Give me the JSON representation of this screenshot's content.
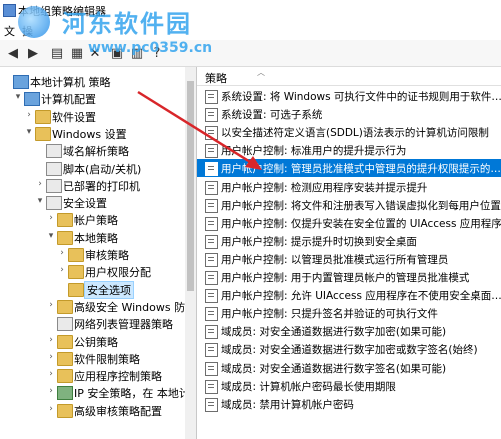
{
  "window": {
    "title": "本地组策略编辑器"
  },
  "menu": {
    "items": [
      "文",
      "操"
    ]
  },
  "watermark": {
    "name": "河东软件园",
    "url": "www.pc0359.cn"
  },
  "tree": {
    "items": [
      {
        "label": "本地计算机 策略",
        "level": 0,
        "expander": "",
        "icon": "computer"
      },
      {
        "label": "计算机配置",
        "level": 1,
        "expander": "▾",
        "icon": "computer"
      },
      {
        "label": "软件设置",
        "level": 2,
        "expander": "›",
        "icon": "folder"
      },
      {
        "label": "Windows 设置",
        "level": 2,
        "expander": "▾",
        "icon": "folder"
      },
      {
        "label": "域名解析策略",
        "level": 3,
        "expander": "",
        "icon": "book"
      },
      {
        "label": "脚本(启动/关机)",
        "level": 3,
        "expander": "",
        "icon": "book"
      },
      {
        "label": "已部署的打印机",
        "level": 3,
        "expander": "›",
        "icon": "book"
      },
      {
        "label": "安全设置",
        "level": 3,
        "expander": "▾",
        "icon": "book"
      },
      {
        "label": "帐户策略",
        "level": 4,
        "expander": "›",
        "icon": "folder"
      },
      {
        "label": "本地策略",
        "level": 4,
        "expander": "▾",
        "icon": "folder"
      },
      {
        "label": "审核策略",
        "level": 5,
        "expander": "›",
        "icon": "folder"
      },
      {
        "label": "用户权限分配",
        "level": 5,
        "expander": "›",
        "icon": "folder"
      },
      {
        "label": "安全选项",
        "level": 5,
        "expander": "",
        "icon": "folder",
        "selected": true
      },
      {
        "label": "高级安全 Windows 防火",
        "level": 4,
        "expander": "›",
        "icon": "folder"
      },
      {
        "label": "网络列表管理器策略",
        "level": 4,
        "expander": "",
        "icon": "book"
      },
      {
        "label": "公钥策略",
        "level": 4,
        "expander": "›",
        "icon": "folder"
      },
      {
        "label": "软件限制策略",
        "level": 4,
        "expander": "›",
        "icon": "folder"
      },
      {
        "label": "应用程序控制策略",
        "level": 4,
        "expander": "›",
        "icon": "folder"
      },
      {
        "label": "IP 安全策略，在 本地计",
        "level": 4,
        "expander": "›",
        "icon": "net"
      },
      {
        "label": "高级审核策略配置",
        "level": 4,
        "expander": "›",
        "icon": "folder"
      }
    ]
  },
  "list": {
    "column_header": "策略",
    "rows": [
      "系统设置: 将 Windows 可执行文件中的证书规则用于软件…",
      "系统设置: 可选子系统",
      "以安全描述符定义语言(SDDL)语法表示的计算机访问限制",
      "用户帐户控制: 标准用户的提升提示行为",
      "用户帐户控制: 管理员批准模式中管理员的提升权限提示的…",
      "用户帐户控制: 检测应用程序安装并提示提升",
      "用户帐户控制: 将文件和注册表写入错误虚拟化到每用户位置",
      "用户帐户控制: 仅提升安装在安全位置的 UIAccess 应用程序",
      "用户帐户控制: 提示提升时切换到安全桌面",
      "用户帐户控制: 以管理员批准模式运行所有管理员",
      "用户帐户控制: 用于内置管理员帐户的管理员批准模式",
      "用户帐户控制: 允许 UIAccess 应用程序在不使用安全桌面…",
      "用户帐户控制: 只提升签名并验证的可执行文件",
      "域成员: 对安全通道数据进行数字加密(如果可能)",
      "域成员: 对安全通道数据进行数字加密或数字签名(始终)",
      "域成员: 对安全通道数据进行数字签名(如果可能)",
      "域成员: 计算机帐户密码最长使用期限",
      "域成员: 禁用计算机帐户密码"
    ],
    "highlight_index": 4
  },
  "colors": {
    "selection": "#0078d7",
    "arrow": "#d8262a"
  }
}
